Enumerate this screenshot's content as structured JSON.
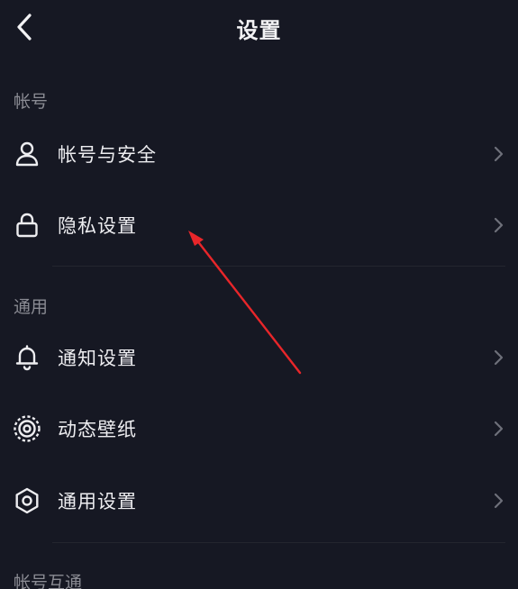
{
  "header": {
    "title": "设置",
    "back_icon": "chevron-left-icon"
  },
  "sections": [
    {
      "label": "帐号",
      "items": [
        {
          "label": "帐号与安全",
          "icon": "person-icon"
        },
        {
          "label": "隐私设置",
          "icon": "lock-icon"
        }
      ]
    },
    {
      "label": "通用",
      "items": [
        {
          "label": "通知设置",
          "icon": "bell-icon"
        },
        {
          "label": "动态壁纸",
          "icon": "live-wallpaper-icon"
        },
        {
          "label": "通用设置",
          "icon": "gear-icon"
        }
      ]
    },
    {
      "label": "帐号互通",
      "items": []
    }
  ],
  "colors": {
    "background": "#161823",
    "text": "#ededf0",
    "section_label": "#8a8b93",
    "chevron": "#6e707a",
    "annotation_arrow": "#e8262a"
  },
  "annotation": {
    "type": "red-arrow",
    "points_to": "隐私设置"
  }
}
